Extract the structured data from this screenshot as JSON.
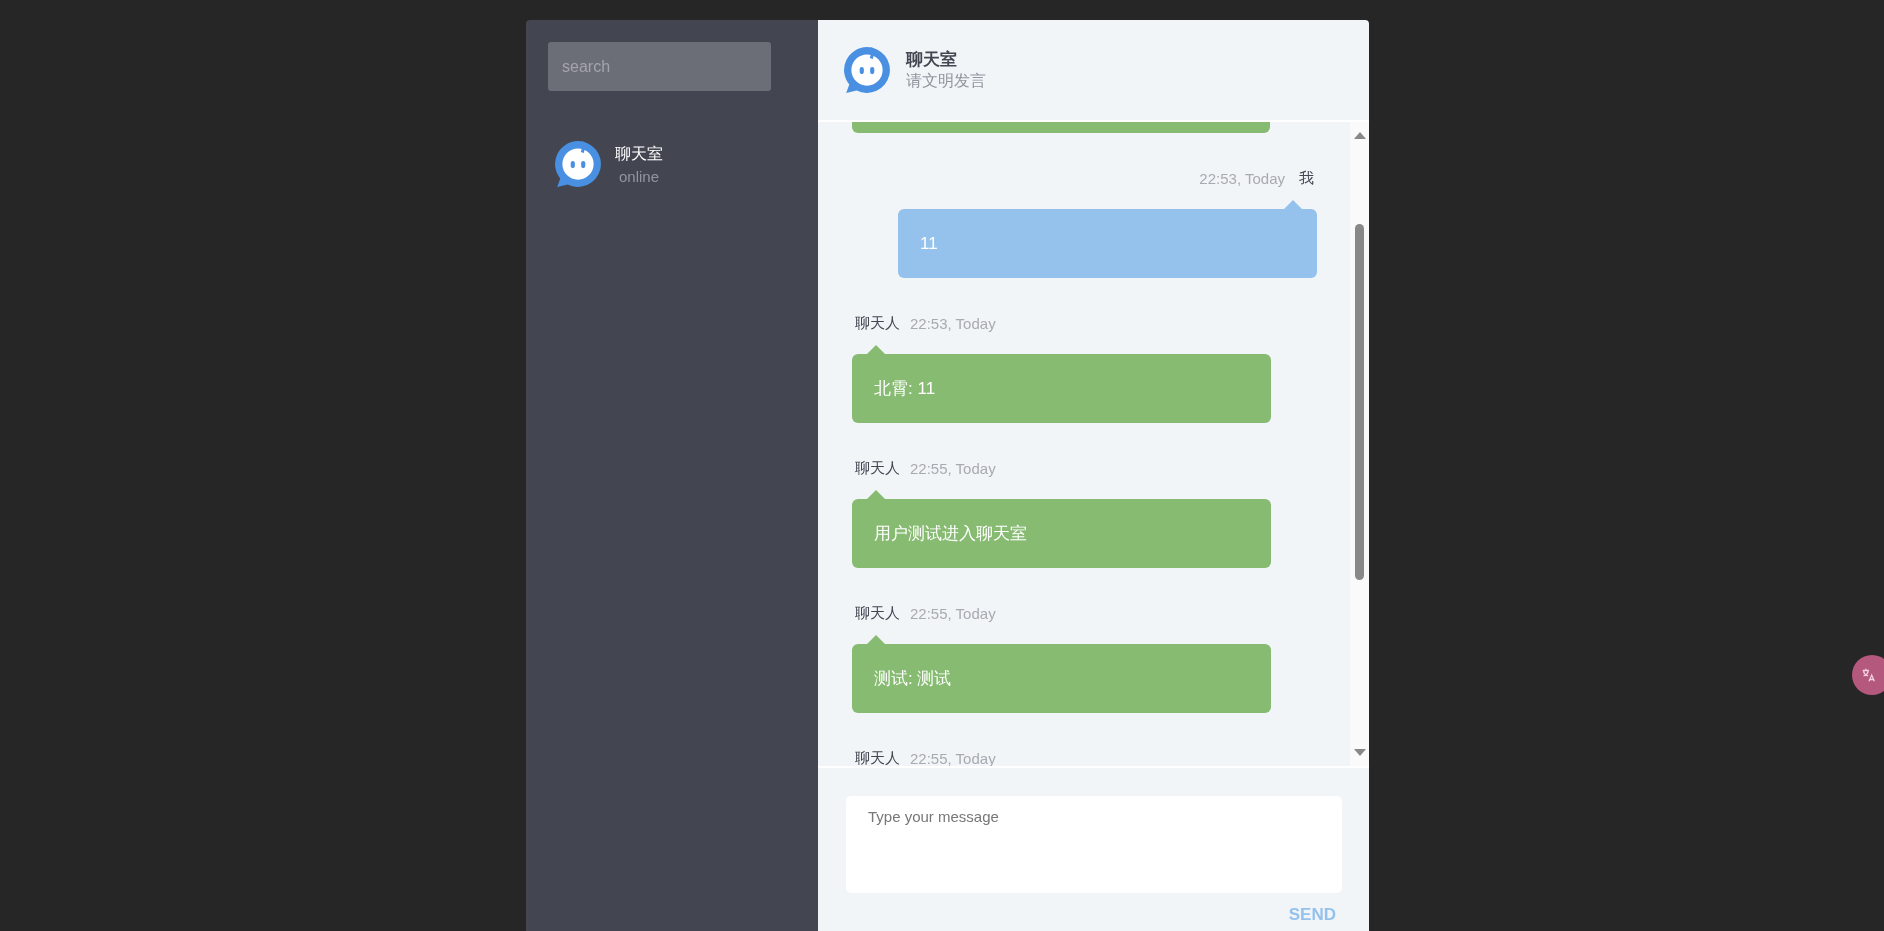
{
  "sidebar": {
    "search": {
      "placeholder": "search"
    },
    "contacts": [
      {
        "name": "聊天室",
        "status": "online"
      }
    ]
  },
  "chat": {
    "title": "聊天室",
    "subtitle": "请文明发言"
  },
  "messages": [
    {
      "kind": "clipped"
    },
    {
      "kind": "sent",
      "sender": "我",
      "time": "22:53, Today",
      "text": "11"
    },
    {
      "kind": "received",
      "sender": "聊天人",
      "time": "22:53, Today",
      "text": "北霄: 11"
    },
    {
      "kind": "received",
      "sender": "聊天人",
      "time": "22:55, Today",
      "text": "用户测试进入聊天室"
    },
    {
      "kind": "received",
      "sender": "聊天人",
      "time": "22:55, Today",
      "text": "测试: 测试"
    },
    {
      "kind": "received",
      "sender": "聊天人",
      "time": "22:55, Today"
    }
  ],
  "composer": {
    "placeholder": "Type your message",
    "send": "SEND"
  }
}
